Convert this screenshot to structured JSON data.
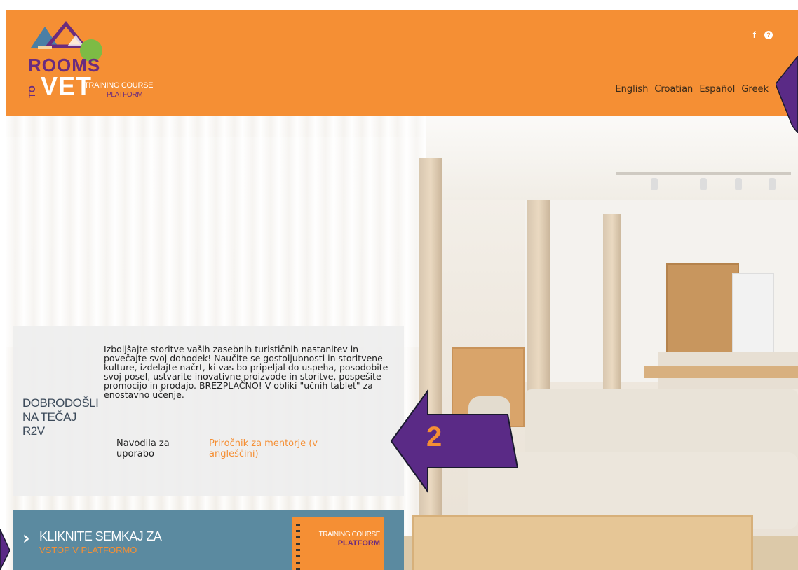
{
  "header": {
    "logo": {
      "rooms": "ROOMS",
      "to": "TO",
      "vet": "VET",
      "training_course": "TRAINING COURSE",
      "platform": "PLATFORM"
    },
    "social": {
      "facebook": "f",
      "help": "?"
    },
    "languages": [
      "English",
      "Croatian",
      "Español",
      "Greek"
    ]
  },
  "welcome": {
    "title_line1": "DOBRODOŠLI",
    "title_line2": "NA TEČAJ R2V",
    "text": "Izboljšajte storitve vaših zasebnih turističnih nastanitev in povečajte svoj dohodek! Naučite se gostoljubnosti in storitvene kulture, izdelajte načrt, ki vas bo pripeljal do uspeha, posodobite svoj posel, ustvarite inovativne proizvode in storitve, pospešite promocijo in prodajo. BREZPLAČNO! V obliki \"učnih tablet\" za enostavno učenje.",
    "link_guide": "Navodila za uporabo",
    "link_mentor": "Priročnik za mentorje (v angleščini)"
  },
  "enter": {
    "chevron": "›",
    "line1": "KLIKNITE SEMKAJ ZA",
    "line2": "VSTOP V PLATFORMO",
    "notebook_tc": "TRAINING COURSE",
    "notebook_pf": "PLATFORM"
  },
  "annotation": {
    "number": "2"
  },
  "colors": {
    "header_bg": "#f58f34",
    "accent_purple": "#6b2c7e",
    "enter_bg": "#5b8aa0"
  }
}
